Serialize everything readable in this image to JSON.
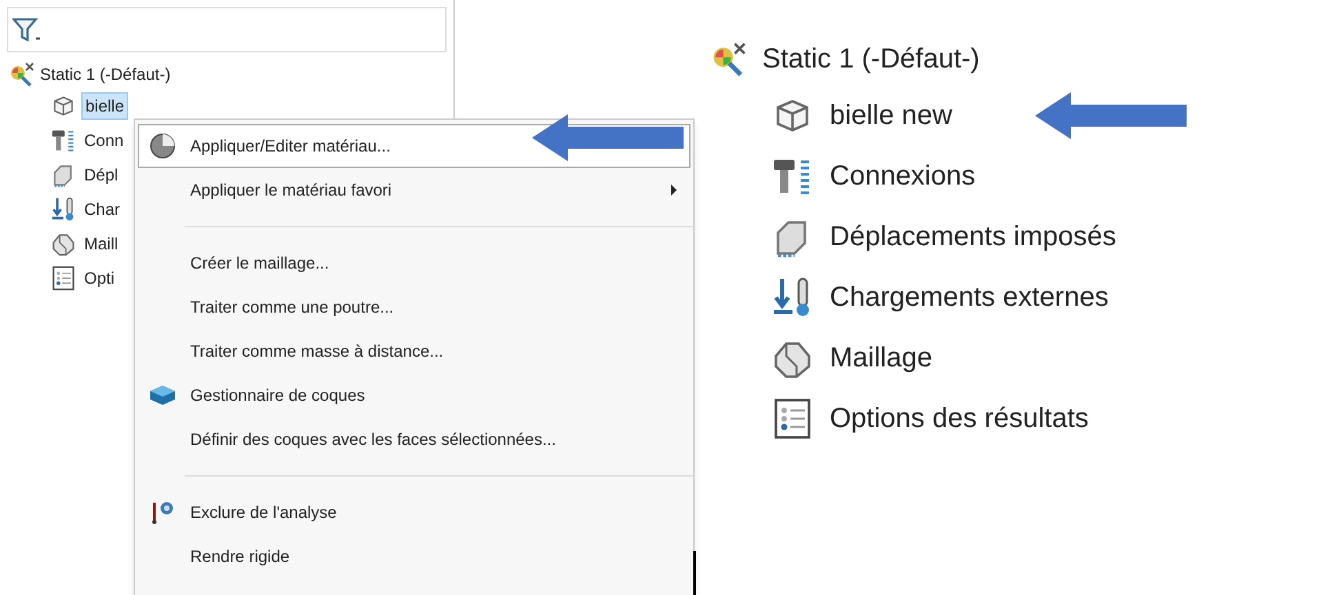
{
  "left_panel": {
    "tree": {
      "label": "Static 1 (-Défaut-)",
      "children": [
        {
          "label": "bielle",
          "selected": true
        },
        {
          "label": "Conn",
          "selected": false
        },
        {
          "label": "Dépl",
          "selected": false
        },
        {
          "label": "Char",
          "selected": false
        },
        {
          "label": "Maill",
          "selected": false
        },
        {
          "label": "Opti",
          "selected": false
        }
      ]
    },
    "context_menu": [
      {
        "kind": "item",
        "label": "Appliquer/Editer matériau...",
        "selected": true,
        "submenu": false
      },
      {
        "kind": "item",
        "label": "Appliquer le matériau favori",
        "selected": false,
        "submenu": true
      },
      {
        "kind": "separator"
      },
      {
        "kind": "item",
        "label": "Créer le maillage...",
        "selected": false,
        "submenu": false
      },
      {
        "kind": "item",
        "label": "Traiter comme une poutre...",
        "selected": false,
        "submenu": false
      },
      {
        "kind": "item",
        "label": "Traiter comme masse à distance...",
        "selected": false,
        "submenu": false
      },
      {
        "kind": "item",
        "label": "Gestionnaire de coques",
        "selected": false,
        "submenu": false
      },
      {
        "kind": "item",
        "label": "Définir des coques avec les faces sélectionnées...",
        "selected": false,
        "submenu": false
      },
      {
        "kind": "separator"
      },
      {
        "kind": "item",
        "label": "Exclure de l'analyse",
        "selected": false,
        "submenu": false
      },
      {
        "kind": "item",
        "label": "Rendre rigide",
        "selected": false,
        "submenu": false
      }
    ]
  },
  "right_panel": {
    "tree": {
      "label": "Static 1 (-Défaut-)",
      "children": [
        {
          "label": "bielle new",
          "selected": false
        },
        {
          "label": "Connexions",
          "selected": false
        },
        {
          "label": "Déplacements imposés",
          "selected": false
        },
        {
          "label": "Chargements externes",
          "selected": false
        },
        {
          "label": "Maillage",
          "selected": false
        },
        {
          "label": "Options des résultats",
          "selected": false
        }
      ]
    }
  }
}
